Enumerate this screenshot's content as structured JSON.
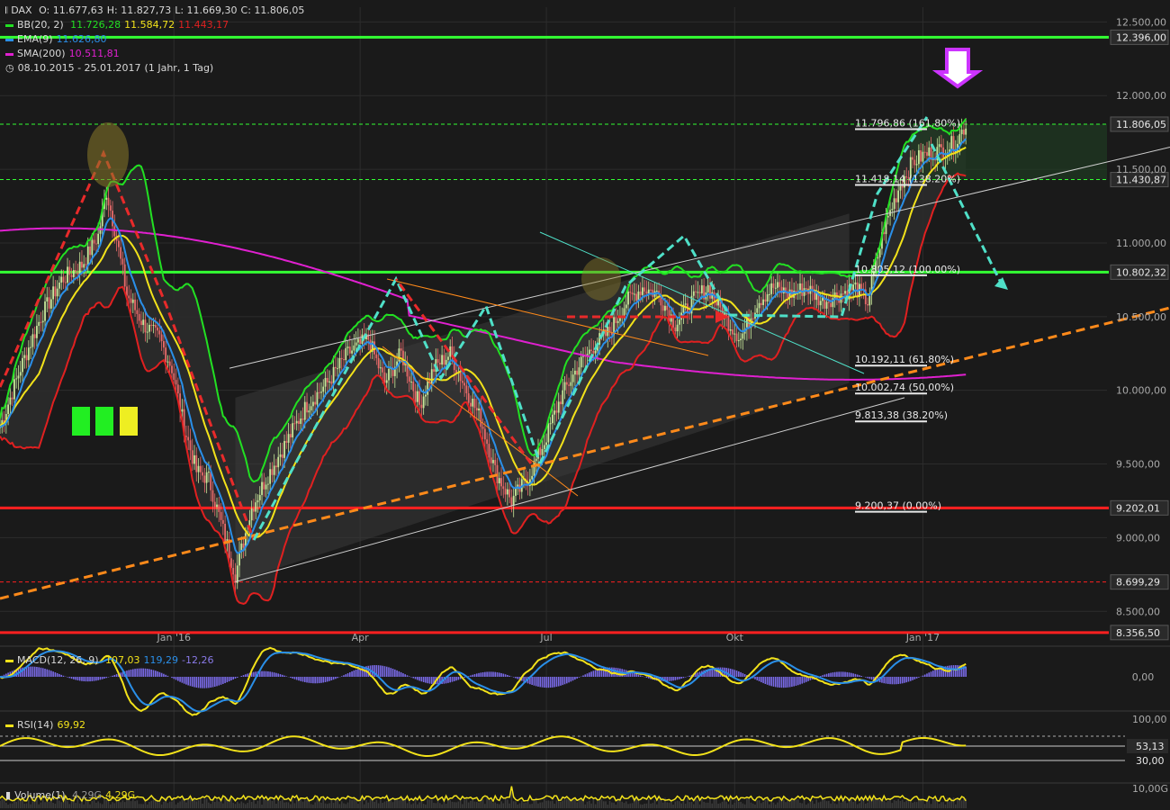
{
  "legend": {
    "symbol": "DAX",
    "ohlc": {
      "o": "O: 11.677,63",
      "h": "H: 11.827,73",
      "l": "L: 11.669,30",
      "c": "C: 11.806,05"
    },
    "bb": {
      "label": "BB(20, 2)",
      "upper": "11.726,28",
      "mid": "11.584,72",
      "lower": "11.443,17"
    },
    "ema": {
      "label": "EMA(9)",
      "value": "11.626,80"
    },
    "sma": {
      "label": "SMA(200)",
      "value": "10.511,81"
    },
    "range": "08.10.2015 - 25.01.2017",
    "range_detail": "(1 Jahr, 1 Tag)"
  },
  "colors": {
    "bg": "#1a1a1a",
    "grid": "#2c2c2c",
    "bb_upper": "#22e022",
    "bb_mid": "#f2e21a",
    "bb_lower": "#e02020",
    "ema": "#2a8fe8",
    "sma": "#e020d0",
    "accent_cyan": "#4fe0c8",
    "orange": "#ff8a1a",
    "red": "#ff2020",
    "green_line": "#33ff33",
    "purple_arrow": "#cc33ff"
  },
  "chart_data": [
    {
      "type": "line",
      "name": "DAX",
      "ylim": [
        8300,
        12600
      ],
      "y_ticks": [
        "12.500,00",
        "12.000,00",
        "11.500,00",
        "11.000,00",
        "10.500,00",
        "10.000,00",
        "9.500,00",
        "9.000,00",
        "8.500,00"
      ],
      "y_tick_values": [
        12500,
        12000,
        11500,
        11000,
        10500,
        10000,
        9500,
        9000,
        8500
      ],
      "x_labels": [
        "Jan '16",
        "Apr",
        "Jul",
        "Okt",
        "Jan '17"
      ],
      "x_label_days": [
        85,
        176,
        267,
        359,
        451
      ],
      "days_total": 475,
      "price_path": [
        [
          0,
          9750
        ],
        [
          10,
          10150
        ],
        [
          20,
          10500
        ],
        [
          30,
          10750
        ],
        [
          40,
          10850
        ],
        [
          48,
          11050
        ],
        [
          52,
          11350
        ],
        [
          56,
          11100
        ],
        [
          62,
          10650
        ],
        [
          70,
          10450
        ],
        [
          78,
          10350
        ],
        [
          84,
          10150
        ],
        [
          90,
          9750
        ],
        [
          96,
          9450
        ],
        [
          102,
          9400
        ],
        [
          108,
          9100
        ],
        [
          115,
          8750
        ],
        [
          123,
          9200
        ],
        [
          130,
          9400
        ],
        [
          140,
          9650
        ],
        [
          150,
          9900
        ],
        [
          160,
          10050
        ],
        [
          170,
          10250
        ],
        [
          180,
          10350
        ],
        [
          188,
          10050
        ],
        [
          196,
          10250
        ],
        [
          205,
          9900
        ],
        [
          212,
          10150
        ],
        [
          220,
          10250
        ],
        [
          228,
          10000
        ],
        [
          235,
          9800
        ],
        [
          242,
          9450
        ],
        [
          250,
          9250
        ],
        [
          258,
          9400
        ],
        [
          266,
          9650
        ],
        [
          274,
          9950
        ],
        [
          282,
          10150
        ],
        [
          290,
          10300
        ],
        [
          298,
          10400
        ],
        [
          306,
          10600
        ],
        [
          314,
          10700
        ],
        [
          322,
          10650
        ],
        [
          330,
          10450
        ],
        [
          338,
          10600
        ],
        [
          346,
          10700
        ],
        [
          354,
          10500
        ],
        [
          362,
          10350
        ],
        [
          370,
          10600
        ],
        [
          378,
          10700
        ],
        [
          386,
          10650
        ],
        [
          394,
          10700
        ],
        [
          402,
          10600
        ],
        [
          410,
          10650
        ],
        [
          418,
          10700
        ],
        [
          424,
          10600
        ],
        [
          432,
          11100
        ],
        [
          440,
          11400
        ],
        [
          446,
          11550
        ],
        [
          452,
          11600
        ],
        [
          460,
          11630
        ],
        [
          467,
          11680
        ],
        [
          472,
          11806
        ]
      ],
      "horizontal_levels": [
        {
          "value": 12396,
          "label": "12.396,00",
          "style": "solid",
          "color": "#33ff33"
        },
        {
          "value": 11806,
          "label": "11.806,05",
          "style": "dashed",
          "color": "#33ff33"
        },
        {
          "value": 11430,
          "label": "11.430,87",
          "style": "dashed",
          "color": "#33ff33"
        },
        {
          "value": 10802,
          "label": "10.802,32",
          "style": "solid",
          "color": "#33ff33"
        },
        {
          "value": 9202,
          "label": "9.202,01",
          "style": "solid",
          "color": "#ff2020"
        },
        {
          "value": 8699,
          "label": "8.699,29",
          "style": "dashed",
          "color": "#ff2020"
        },
        {
          "value": 8356,
          "label": "8.356,50",
          "style": "solid",
          "color": "#ff2020"
        }
      ],
      "fib_levels": [
        {
          "value": 11796.86,
          "label": "11.796,86 (161.80%)"
        },
        {
          "value": 11418.14,
          "label": "11.418,14 (138.20%)"
        },
        {
          "value": 10805.12,
          "label": "10.805,12 (100.00%)"
        },
        {
          "value": 10192.11,
          "label": "10.192,11 (61.80%)"
        },
        {
          "value": 10002.74,
          "label": "10.002,74 (50.00%)"
        },
        {
          "value": 9813.38,
          "label": "9.813,38 (38.20%)"
        },
        {
          "value": 9200.37,
          "label": "9.200,37 (0.00%)"
        }
      ]
    },
    {
      "type": "line",
      "name": "MACD",
      "label": "MACD(12, 26, 9)",
      "values_text": [
        "107,03",
        "119,29",
        "-12,26"
      ],
      "y_ticks": [
        "0,00"
      ]
    },
    {
      "type": "line",
      "name": "RSI",
      "label": "RSI(14)",
      "value": "69,92",
      "y_ticks": [
        "100,00",
        "53,13",
        "30,00"
      ]
    },
    {
      "type": "bar",
      "name": "Volume",
      "label": "Volume(1)",
      "values_text": [
        "4,29G",
        "4,29G"
      ],
      "y_ticks": [
        "10,00G"
      ]
    }
  ]
}
